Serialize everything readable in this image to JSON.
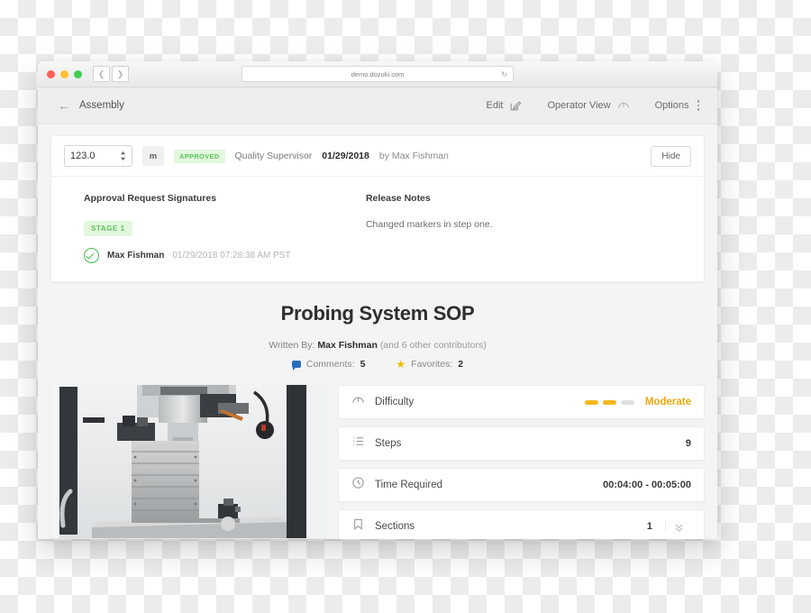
{
  "browser": {
    "url": "demo.dozuki.com",
    "reload_icon": "reload-icon",
    "back_icon": "chevron-left-icon",
    "forward_icon": "chevron-right-icon"
  },
  "toolbar": {
    "back_icon": "arrow-left-icon",
    "title": "Assembly",
    "edit_label": "Edit",
    "edit_icon": "pencil-square-icon",
    "operator_view_label": "Operator View",
    "operator_view_icon": "gauge-icon",
    "options_label": "Options",
    "options_icon": "kebab-menu-icon"
  },
  "approval": {
    "version_value": "123.0",
    "unit": "m",
    "status_badge": "APPROVED",
    "role": "Quality Supervisor",
    "date": "01/29/2018",
    "author": "by Max Fishman",
    "hide_label": "Hide",
    "signatures_heading": "Approval Request Signatures",
    "stage_chip": "STAGE 1",
    "signer_name": "Max Fishman",
    "signer_timestamp": "01/29/2018 07:28:38 AM PST",
    "signer_icon": "check-circle-icon",
    "release_heading": "Release Notes",
    "release_body": "Changed markers in step one."
  },
  "document": {
    "title": "Probing System SOP",
    "written_by_label": "Written By:",
    "author": "Max Fishman",
    "contributors": "(and 6 other contributors)",
    "comments_label": "Comments:",
    "comments_count": "5",
    "comments_icon": "comment-bubble-icon",
    "favorites_label": "Favorites:",
    "favorites_count": "2",
    "favorites_icon": "star-icon"
  },
  "media": {
    "photo_alt": "cnc-milling-machine-photo"
  },
  "info_rows": [
    {
      "icon": "gauge-icon",
      "label": "Difficulty",
      "value": "Moderate",
      "filled_bars": 2,
      "total_bars": 3
    },
    {
      "icon": "list-icon",
      "label": "Steps",
      "value": "9"
    },
    {
      "icon": "clock-icon",
      "label": "Time Required",
      "value": "00:04:00 - 00:05:00"
    },
    {
      "icon": "bookmark-icon",
      "label": "Sections",
      "value": "1",
      "expand_icon": "chevron-double-down-icon"
    }
  ],
  "colors": {
    "accent_amber": "#f5b71a",
    "approved_green": "#5ec45b",
    "approved_bg": "#e3f7df",
    "comment_blue": "#2a6ebb",
    "star_gold": "#f2b705",
    "page_bg": "#f4f4f4"
  }
}
